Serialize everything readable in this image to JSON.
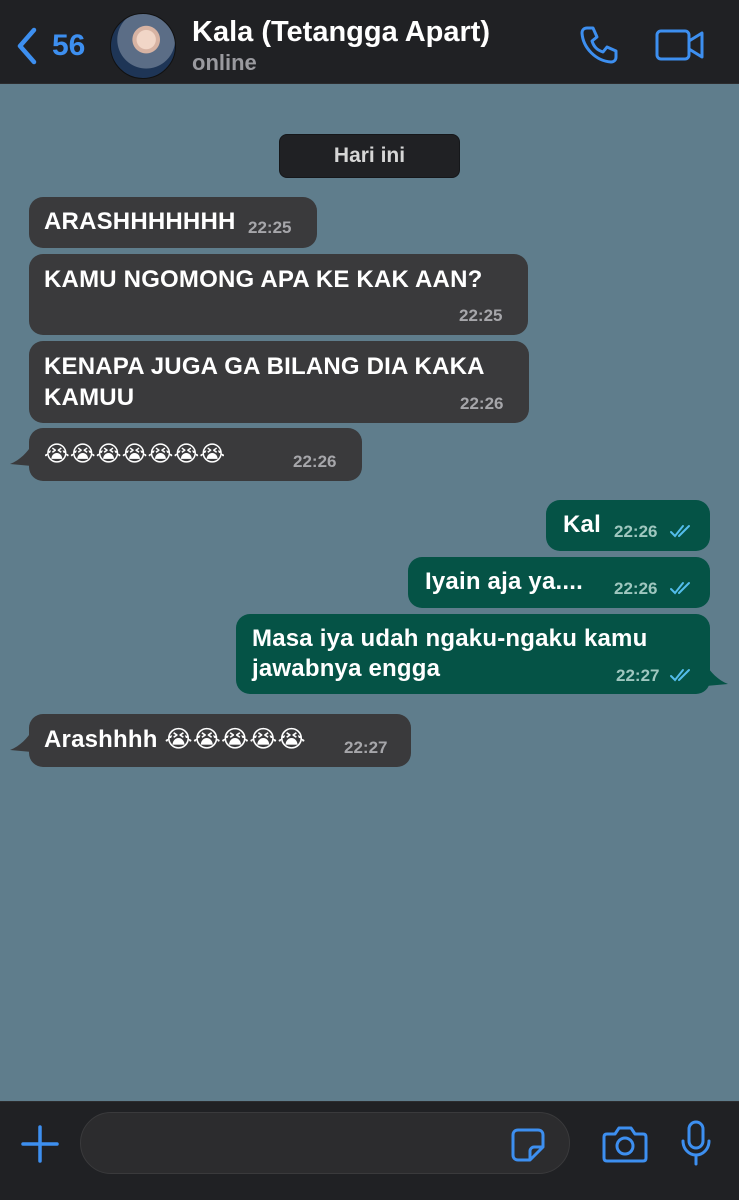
{
  "header": {
    "back_count": "56",
    "contact_name": "Kala (Tetangga Apart)",
    "contact_status": "online",
    "back_icon": "chevron-left-icon",
    "call_icon": "phone-icon",
    "video_icon": "video-camera-icon"
  },
  "date_chip": "Hari ini",
  "messages": [
    {
      "direction": "in",
      "text": "ARASHHHHHHH",
      "time": "22:25"
    },
    {
      "direction": "in",
      "text": "KAMU NGOMONG APA KE KAK AAN?",
      "time": "22:25"
    },
    {
      "direction": "in",
      "text_line1": "KENAPA JUGA GA BILANG DIA KAKA",
      "text_line2": "KAMUU",
      "time": "22:26"
    },
    {
      "direction": "in",
      "text": "😭😭😭😭😭😭😭",
      "time": "22:26"
    },
    {
      "direction": "out",
      "text": "Kal",
      "time": "22:26",
      "status": "read"
    },
    {
      "direction": "out",
      "text": "Iyain aja ya....",
      "time": "22:26",
      "status": "read"
    },
    {
      "direction": "out",
      "text_line1": "Masa iya udah ngaku-ngaku kamu",
      "text_line2": "jawabnya engga",
      "time": "22:27",
      "status": "read"
    },
    {
      "direction": "in",
      "text": "Arashhhh 😭😭😭😭😭",
      "time": "22:27"
    }
  ],
  "composer": {
    "value": "",
    "plus_icon": "plus-icon",
    "sticker_icon": "sticker-icon",
    "camera_icon": "camera-icon",
    "mic_icon": "microphone-icon"
  },
  "colors": {
    "accent": "#3d8ff0",
    "chat_background": "#5f7d8c",
    "incoming_bubble": "#3a3a3c",
    "outgoing_bubble": "#055346",
    "read_tick": "#53bdeb"
  }
}
